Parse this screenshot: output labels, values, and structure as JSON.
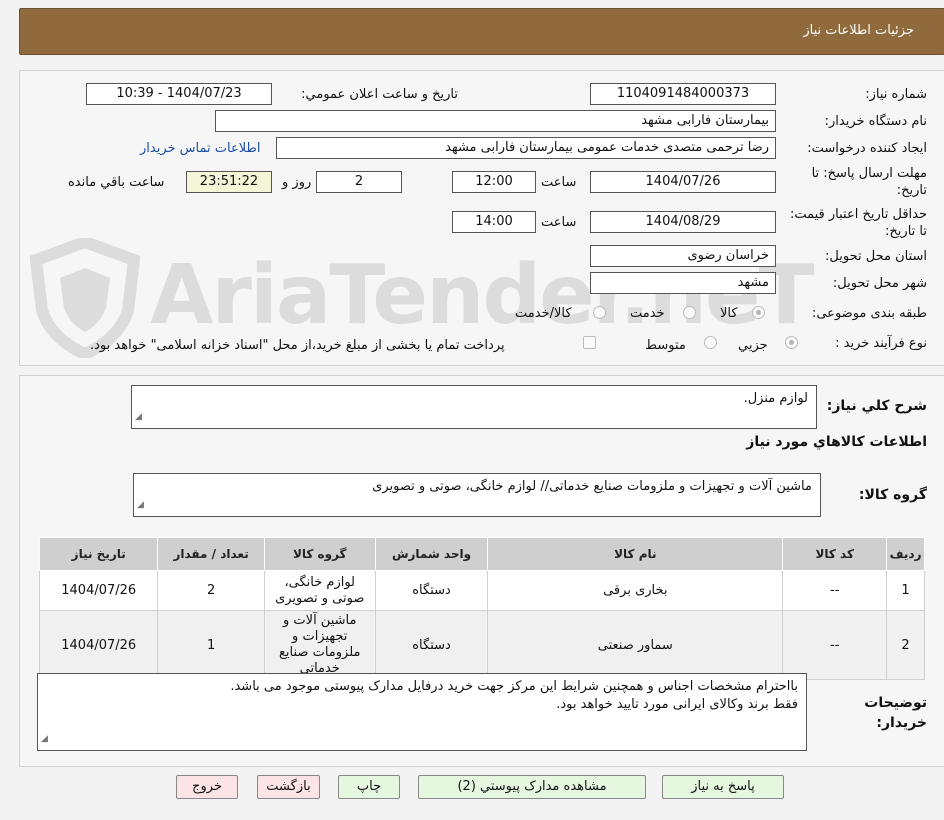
{
  "header": {
    "title": "جزئیات اطلاعات نیاز"
  },
  "watermark": {
    "text": "AriaTender.neT"
  },
  "form": {
    "need_number_label": "شماره نیاز:",
    "need_number": "1104091484000373",
    "announce_label": "تاریخ و ساعت اعلان عمومي:",
    "announce_value": "1404/07/23 - 10:39",
    "buyer_label": "نام دستگاه خریدار:",
    "buyer_value": "بیمارستان فارابی مشهد",
    "creator_label": "ایجاد کننده درخواست:",
    "creator_value": "رضا ترحمی متصدی خدمات عمومی بیمارستان فارابی مشهد",
    "contact_link": "اطلاعات تماس خریدار",
    "deadline_label": "مهلت ارسال پاسخ: تا تاریخ:",
    "deadline_date": "1404/07/26",
    "time_label": "ساعت",
    "deadline_time": "12:00",
    "days_value": "2",
    "days_label": "روز و",
    "remaining_time": "23:51:22",
    "remaining_label": "ساعت باقي مانده",
    "validity_label": "حداقل تاریخ اعتبار قیمت: تا تاریخ:",
    "validity_date": "1404/08/29",
    "validity_time": "14:00",
    "province_label": "استان محل تحویل:",
    "province_value": "خراسان رضوی",
    "city_label": "شهر محل تحویل:",
    "city_value": "مشهد",
    "category_label": "طبقه بندی موضوعی:",
    "category_options": [
      "کالا",
      "خدمت",
      "کالا/خدمت"
    ],
    "process_label": "نوع فرآیند خرید :",
    "process_options": [
      "جزیي",
      "متوسط"
    ],
    "payment_note": "پرداخت تمام یا بخشی از مبلغ خرید،از محل \"اسناد خزانه اسلامی\" خواهد بود."
  },
  "details": {
    "summary_label": "شرح کلي نیاز:",
    "summary_value": "لوازم منزل.",
    "goods_info_title": "اطلاعات کالاهاي مورد نیاز",
    "goods_group_label": "گروه کالا:",
    "goods_group_value": "ماشین آلات و تجهیزات و ملزومات صنایع خدماتی// لوازم خانگی، صوتی و تصویری",
    "table_headers": [
      "ردیف",
      "کد کالا",
      "نام کالا",
      "واحد شمارش",
      "گروه کالا",
      "تعداد / مقدار",
      "تاریخ نیاز"
    ],
    "rows": [
      {
        "idx": "1",
        "code": "--",
        "name": "بخاری برقی",
        "unit": "دستگاه",
        "group": "لوازم خانگی، صوتی و تصویری",
        "qty": "2",
        "date": "1404/07/26"
      },
      {
        "idx": "2",
        "code": "--",
        "name": "سماور صنعتی",
        "unit": "دستگاه",
        "group": "ماشین آلات و تجهیزات و ملزومات صنایع خدماتی",
        "qty": "1",
        "date": "1404/07/26"
      }
    ],
    "buyer_notes_label": "توضیحات خریدار:",
    "buyer_notes_line1": "بااحترام مشخصات اجناس و همچنین شرایط این مرکز جهت خرید درفایل مدارک پیوستی موجود می باشد.",
    "buyer_notes_line2": "فقط برند وکالای ایرانی مورد تایید خواهد بود."
  },
  "buttons": {
    "reply": "پاسخ به نیاز",
    "attachments": "مشاهده مدارک پیوستي (2)",
    "print": "چاپ",
    "back": "بازگشت",
    "exit": "خروج"
  }
}
